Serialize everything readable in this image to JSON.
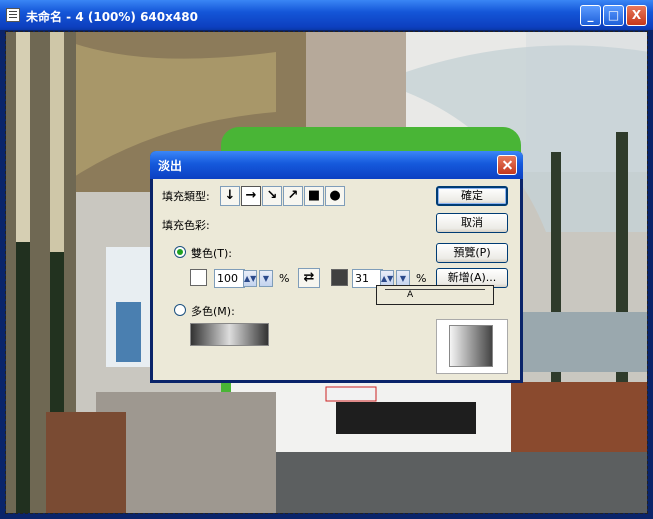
{
  "window": {
    "title": "未命名 - 4 (100%) 640x480",
    "controls": {
      "minimize": "_",
      "maximize": "□",
      "close": "X"
    }
  },
  "dialog": {
    "title": "淡出",
    "fill_type_label": "填充類型:",
    "fill_color_label": "填充色彩:",
    "two_color_label": "雙色(T):",
    "multi_color_label": "多色(M):",
    "start_value": "100",
    "end_value": "31",
    "percent_symbol": "%",
    "buttons": {
      "ok": "確定",
      "cancel": "取消",
      "preview": "預覽(P)",
      "add": "新增(A)..."
    },
    "fill_types": [
      "down-arrow-icon",
      "right-arrow-icon",
      "diagonal-down-icon",
      "diagonal-up-icon",
      "rectangle-icon",
      "radial-icon"
    ],
    "selected_fill_type": "right-arrow-icon",
    "start_color": "#ffffff",
    "end_color": "#404040"
  }
}
